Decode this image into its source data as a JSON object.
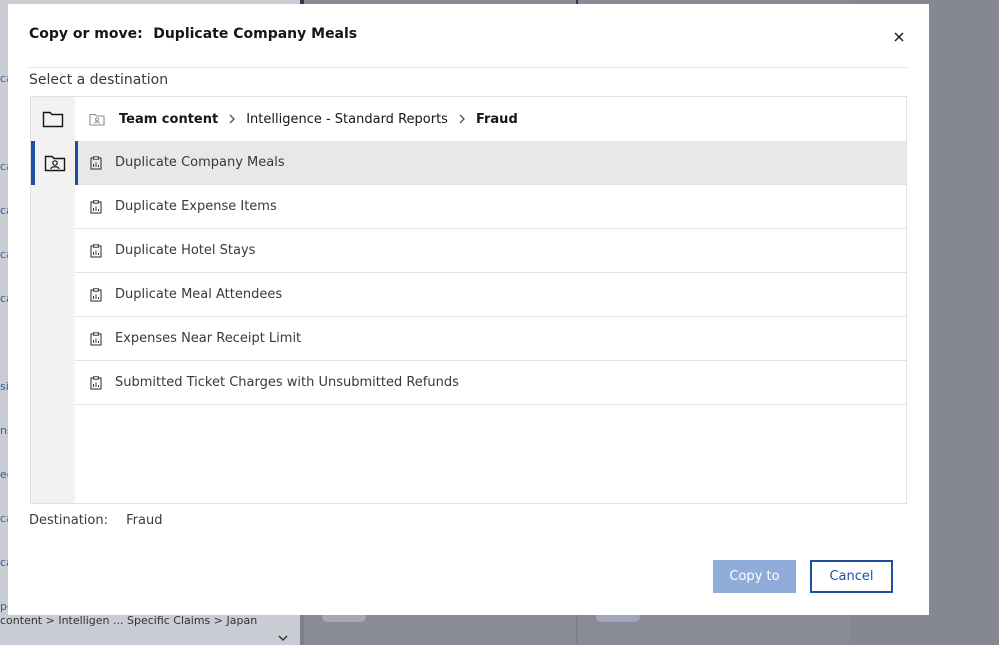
{
  "background": {
    "left_rows": [
      "ca",
      "ca",
      "ca",
      "ca",
      "ca",
      "sig",
      "ns",
      "ec",
      "ca",
      "ca",
      "pe"
    ],
    "breadcrumb": "content > Intelligen ... Specific Claims > Japan"
  },
  "modal": {
    "title_prefix": "Copy or move:",
    "title_name": "Duplicate Company Meals",
    "close_icon": "close-icon",
    "section_label": "Select a destination",
    "rail": [
      {
        "icon": "folder-icon",
        "active": false
      },
      {
        "icon": "user-folder-icon",
        "active": true
      }
    ],
    "breadcrumb": {
      "icon": "team-folder-icon",
      "items": [
        "Team content",
        "Intelligence - Standard Reports",
        "Fraud"
      ]
    },
    "items": [
      {
        "label": "Duplicate Company Meals",
        "icon": "report-icon",
        "selected": true
      },
      {
        "label": "Duplicate Expense Items",
        "icon": "report-icon",
        "selected": false
      },
      {
        "label": "Duplicate Hotel Stays",
        "icon": "report-icon",
        "selected": false
      },
      {
        "label": "Duplicate Meal Attendees",
        "icon": "report-icon",
        "selected": false
      },
      {
        "label": "Expenses Near Receipt Limit",
        "icon": "report-icon",
        "selected": false
      },
      {
        "label": "Submitted Ticket Charges with Unsubmitted Refunds",
        "icon": "report-icon",
        "selected": false
      }
    ],
    "destination_label": "Destination:",
    "destination_value": "Fraud",
    "buttons": {
      "copy_label": "Copy to",
      "cancel_label": "Cancel"
    }
  },
  "colors": {
    "accent": "#1f4f9e",
    "disabled_button": "#8fadd8",
    "selected_row": "#e8e8e8"
  }
}
